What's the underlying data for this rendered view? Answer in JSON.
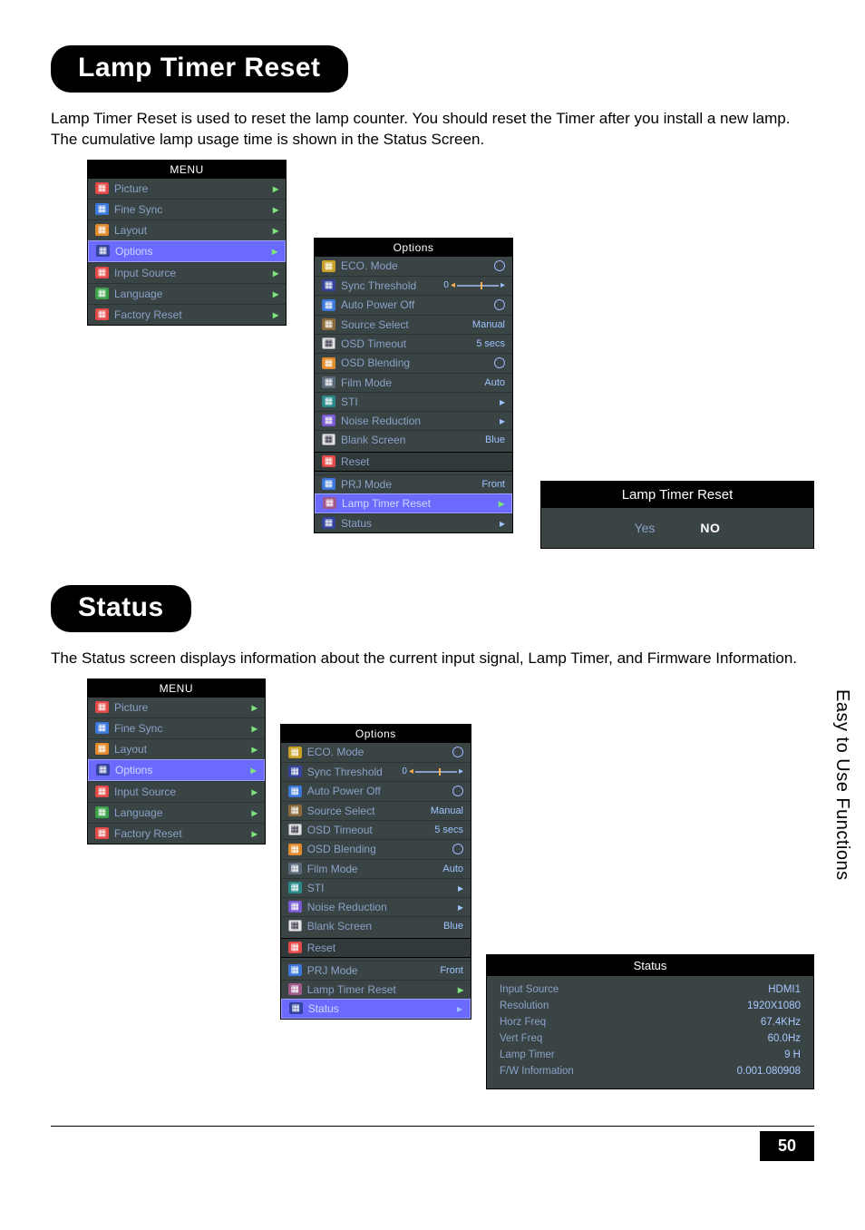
{
  "sideTab": "Easy to Use Functions",
  "pageNumber": "50",
  "section1": {
    "heading": "Lamp Timer Reset",
    "body": "Lamp Timer Reset is used to reset the lamp counter. You should reset the Timer after you install a new lamp. The cumulative lamp usage time is shown in the Status Screen."
  },
  "section2": {
    "heading": "Status",
    "body": "The Status screen displays information about the current input signal, Lamp Timer, and Firmware Information."
  },
  "mainMenu": {
    "title": "MENU",
    "items": [
      {
        "icon": "i-red",
        "label": "Picture"
      },
      {
        "icon": "i-blue",
        "label": "Fine Sync"
      },
      {
        "icon": "i-orange",
        "label": "Layout"
      },
      {
        "icon": "i-navy",
        "label": "Options",
        "selected": true
      },
      {
        "icon": "i-red",
        "label": "Input Source"
      },
      {
        "icon": "i-green",
        "label": "Language"
      },
      {
        "icon": "i-red",
        "label": "Factory Reset"
      }
    ]
  },
  "optionsMenu": {
    "title": "Options",
    "sliderValue": "0",
    "rows": [
      {
        "icon": "i-yellow",
        "label": "ECO. Mode",
        "value": "circle"
      },
      {
        "icon": "i-navy",
        "label": "Sync Threshold",
        "value": "slider"
      },
      {
        "icon": "i-blue",
        "label": "Auto Power Off",
        "value": "circle"
      },
      {
        "icon": "i-brown",
        "label": "Source Select",
        "value": "Manual"
      },
      {
        "icon": "i-white",
        "label": "OSD Timeout",
        "value": "5 secs"
      },
      {
        "icon": "i-orange",
        "label": "OSD Blending",
        "value": "circle"
      },
      {
        "icon": "i-slate",
        "label": "Film Mode",
        "value": "Auto"
      },
      {
        "icon": "i-teal",
        "label": "STI",
        "value": "arrow"
      },
      {
        "icon": "i-violet",
        "label": "Noise Reduction",
        "value": "arrow"
      },
      {
        "icon": "i-white",
        "label": "Blank Screen",
        "value": "Blue"
      },
      {
        "icon": "i-red",
        "label": "Reset",
        "value": "",
        "reset": true
      },
      {
        "icon": "i-blue",
        "label": "PRJ Mode",
        "value": "Front"
      },
      {
        "icon": "i-pink",
        "label": "Lamp Timer Reset",
        "value": "arrow-green",
        "sel1": true
      },
      {
        "icon": "i-navy",
        "label": "Status",
        "value": "arrow",
        "sel2": true
      }
    ]
  },
  "ltrDialog": {
    "title": "Lamp Timer Reset",
    "yes": "Yes",
    "no": "NO"
  },
  "statusPanel": {
    "title": "Status",
    "rows": [
      {
        "label": "Input Source",
        "value": "HDMI1"
      },
      {
        "label": "Resolution",
        "value": "1920X1080"
      },
      {
        "label": "Horz Freq",
        "value": "67.4KHz"
      },
      {
        "label": "Vert Freq",
        "value": "60.0Hz"
      },
      {
        "label": "Lamp Timer",
        "value": "9 H"
      },
      {
        "label": "F/W Information",
        "value": "0.001.080908"
      }
    ]
  }
}
